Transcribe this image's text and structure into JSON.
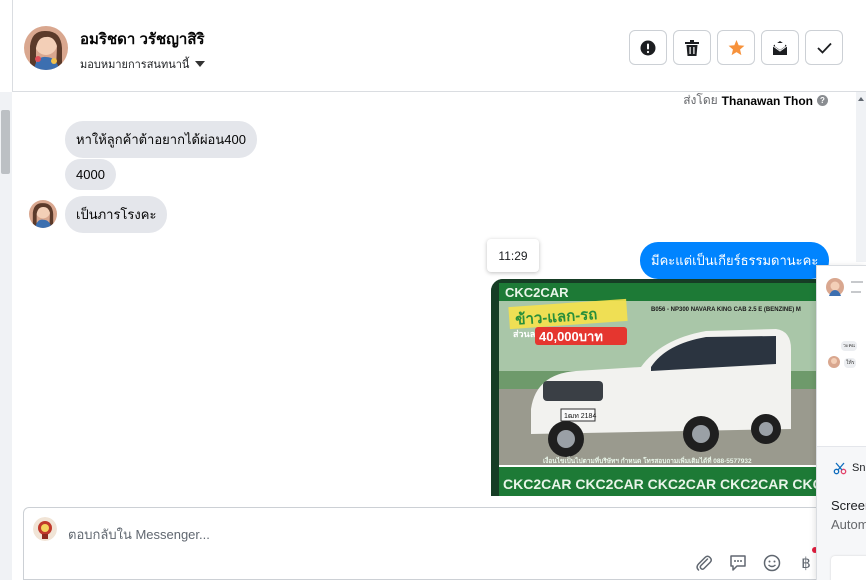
{
  "header": {
    "contact_name": "อมริชดา วรัชญาสิริ",
    "assign_label": "มอบหมายการสนทนานี้",
    "actions": [
      {
        "name": "spam-button",
        "icon": "exclamation-circle-icon"
      },
      {
        "name": "delete-button",
        "icon": "trash-icon"
      },
      {
        "name": "star-button",
        "icon": "star-icon"
      },
      {
        "name": "mark-unread-button",
        "icon": "envelope-icon"
      },
      {
        "name": "mark-done-button",
        "icon": "check-icon"
      }
    ]
  },
  "chat": {
    "sent_by_prefix": "ส่งโดย",
    "sent_by_name": "Thanawan Thon",
    "messages": [
      {
        "direction": "in",
        "text": "หาให้ลูกค้าต้าอยากได้ผ่อน400"
      },
      {
        "direction": "in",
        "text": "4000"
      },
      {
        "direction": "in",
        "text": "เป็นภารโรงคะ"
      },
      {
        "direction": "out",
        "text": "มีคะแต่เป็นเกียร์ธรรมดานะคะ"
      }
    ],
    "time_tooltip": "11:29",
    "photo": {
      "banner_brand": "CKC2CAR",
      "promo_text": "ข้าว-แลก-รถ",
      "discount_label": "ส่วนลด",
      "discount_value": "40,000บาท",
      "model_code": "B056 - NP300 NAVARA KING CAB 2.5 E (BENZINE) M",
      "plate": "1ฒท 2184",
      "footer_text": "เงื่อนไขเป็นไปตามที่บริษัทฯ กำหนด โทรสอบถามเพิ่มเติมได้ที่ 088-5577932",
      "footer_brand": "CKC2CAR CKC2CAR CKC2CAR CKC2CAR CKC"
    }
  },
  "composer": {
    "placeholder": "ตอบกลับใน Messenger...",
    "tools": [
      "paperclip-icon",
      "speech-bubble-icon",
      "smiley-icon",
      "baht-icon"
    ],
    "baht_symbol": "฿"
  },
  "overlay": {
    "app_label": "Sn",
    "title": "Screen",
    "subtitle": "Autom"
  },
  "colors": {
    "outgoing_bubble": "#0084ff",
    "incoming_bubble": "#e4e6eb",
    "star": "#f7923b"
  }
}
